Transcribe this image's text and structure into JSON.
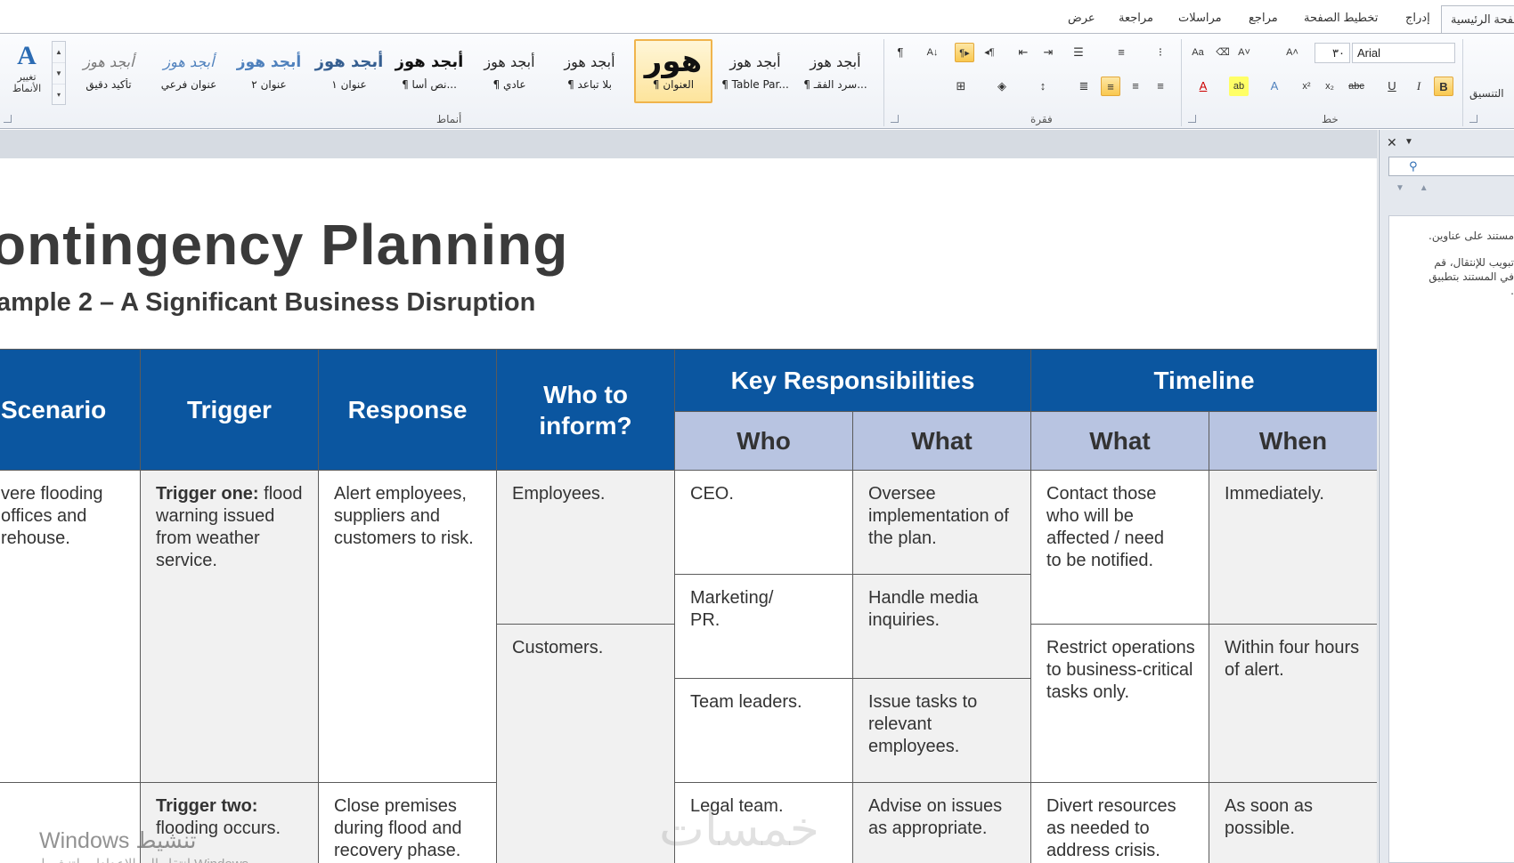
{
  "ribbon_tabs": [
    "عرض",
    "مراجعة",
    "مراسلات",
    "مراجع",
    "تخطيط الصفحة",
    "إدراج",
    "الصفحة الرئيسية"
  ],
  "ribbon": {
    "change_styles": "تغيير الأنماط",
    "styles_group": "أنماط",
    "paragraph_group": "فقرة",
    "font_group": "خط",
    "clipboard_group": "التنسيق",
    "font_name": "Arial",
    "font_size": "٣٠",
    "style_gallery": [
      {
        "sample": "أبجد هوز",
        "label": "¶ سرد الفقـ..."
      },
      {
        "sample": "أبجد هوز",
        "label": "¶ Table Par..."
      },
      {
        "sample": "هور",
        "label": "¶ العنوان"
      },
      {
        "sample": "أبجد هوز",
        "label": "¶ بلا تباعد"
      },
      {
        "sample": "أبجد هوز",
        "label": "¶ عادي"
      },
      {
        "sample": "أبجد هوز",
        "label": "¶ نص أسا..."
      },
      {
        "sample": "أبجد هوز",
        "label": "عنوان ١"
      },
      {
        "sample": "أبجد هوز",
        "label": "عنوان ٢"
      },
      {
        "sample": "أبجد هوز",
        "label": "عنوان فرعي"
      },
      {
        "sample": "أبجد هوز",
        "label": "تأكيد دقيق"
      }
    ]
  },
  "document": {
    "title": "ontingency  Planning",
    "subtitle": "ample 2 – A Significant Business Disruption",
    "table": {
      "headers": {
        "scenario": "Scenario",
        "trigger": "Trigger",
        "response": "Response",
        "who_to_inform": "Who to inform?",
        "key_responsibilities": "Key  Responsibilities",
        "timeline": "Timeline",
        "who": "Who",
        "what": "What",
        "timeline_what": "What",
        "when": "When"
      },
      "cells": {
        "scenario_1": "vere flooding offices and rehouse.",
        "trigger_1_label": "Trigger one:",
        "trigger_1_text": " flood warning issued from weather service.",
        "response_1": "Alert employees, suppliers and customers to risk.",
        "inform_1": "Employees.",
        "who_1": "CEO.",
        "what_1": "Oversee implementation of the plan.",
        "tl_what_1": "Contact those who will be affected / need to be notified.",
        "when_1": "Immediately.",
        "who_2": "Marketing/ PR.",
        "what_2": "Handle media inquiries.",
        "tl_what_2": "Restrict operations to business-critical tasks only.",
        "when_2": "Within four hours of alert.",
        "inform_2": "Customers.",
        "who_3": "Team leaders.",
        "what_3": "Issue tasks to relevant employees.",
        "trigger_2_label": "Trigger two:",
        "trigger_2_text": " flooding occurs.",
        "response_2": "Close premises during flood and recovery phase.",
        "who_4": "Legal team.",
        "what_4": "Advise on issues as appropriate.",
        "tl_what_3": "Divert resources as needed to address crisis.",
        "when_3": "As soon as possible."
      }
    }
  },
  "nav_pane": {
    "text_1": "مستند على عناوين.",
    "text_2": "تبويب للإنتقال، قم",
    "text_3": "في المستند بتطبيق",
    "text_4": "."
  },
  "overlays": {
    "watermark": "خمسات",
    "activate_windows": "Windows تنشيط",
    "activate_windows_sub": "انتقل إلى الإعدادات لتنشيط Windows"
  }
}
